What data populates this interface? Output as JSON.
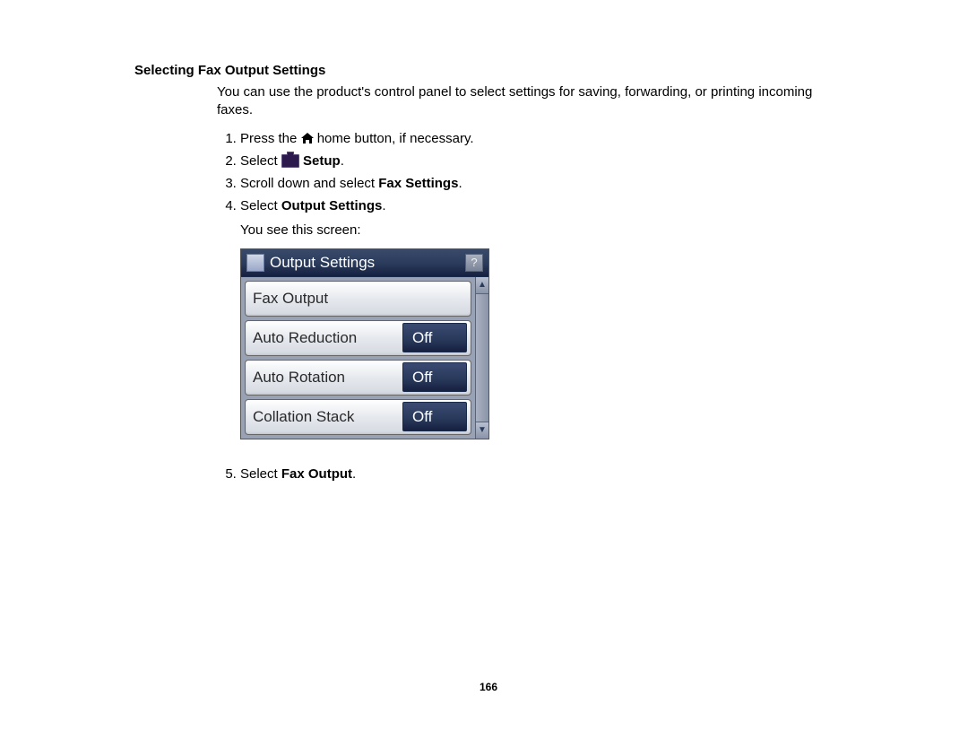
{
  "heading": "Selecting Fax Output Settings",
  "intro": "You can use the product's control panel to select settings for saving, forwarding, or printing incoming faxes.",
  "steps": {
    "s1_pre": "Press the ",
    "s1_post": " home button, if necessary.",
    "s2_pre": "Select ",
    "s2_bold": " Setup",
    "s2_post": ".",
    "s3_pre": "Scroll down and select ",
    "s3_bold": "Fax Settings",
    "s3_post": ".",
    "s4_pre": "Select ",
    "s4_bold": "Output Settings",
    "s4_post": ".",
    "s4_sub": "You see this screen:",
    "s5_pre": "Select ",
    "s5_bold": "Fax Output",
    "s5_post": "."
  },
  "lcd": {
    "title": "Output Settings",
    "rows": [
      {
        "label": "Fax Output",
        "value": ""
      },
      {
        "label": "Auto Reduction",
        "value": "Off"
      },
      {
        "label": "Auto Rotation",
        "value": "Off"
      },
      {
        "label": "Collation Stack",
        "value": "Off"
      }
    ],
    "help": "?",
    "scroll_up": "▲",
    "scroll_down": "▼"
  },
  "page_number": "166"
}
